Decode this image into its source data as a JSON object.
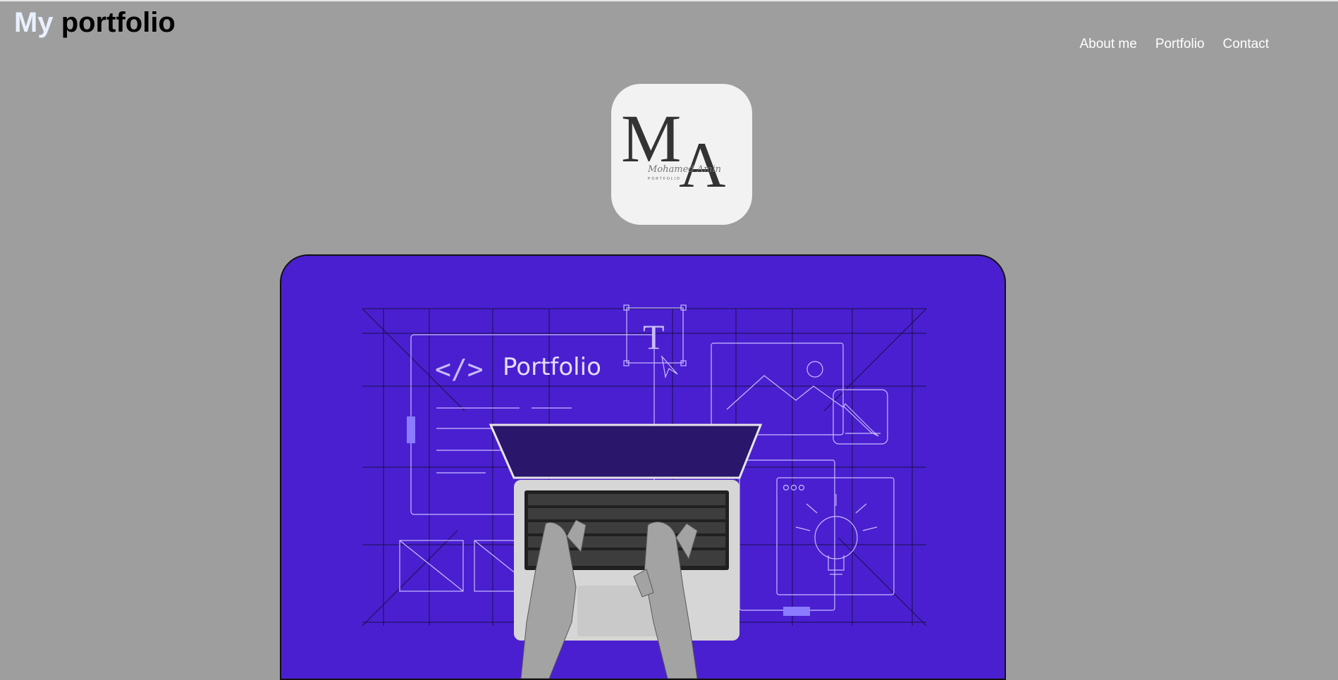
{
  "header": {
    "title_accent": "My",
    "title_rest": " portfolio"
  },
  "nav": {
    "items": [
      {
        "label": "About me"
      },
      {
        "label": "Portfolio"
      },
      {
        "label": "Contact"
      }
    ]
  },
  "logo": {
    "monogram_left": "M",
    "monogram_right": "A",
    "signature": "Mohamed Amin",
    "tagline": "PORTFOLIO"
  },
  "hero": {
    "card_title": "Portfolio",
    "code_glyph": "</>",
    "text_tool_glyph": "T"
  },
  "colors": {
    "page_background": "#9e9e9e",
    "hero_background": "#4a1fd0",
    "line_color": "#b9a8ff",
    "accent_block": "#8b7bff"
  }
}
